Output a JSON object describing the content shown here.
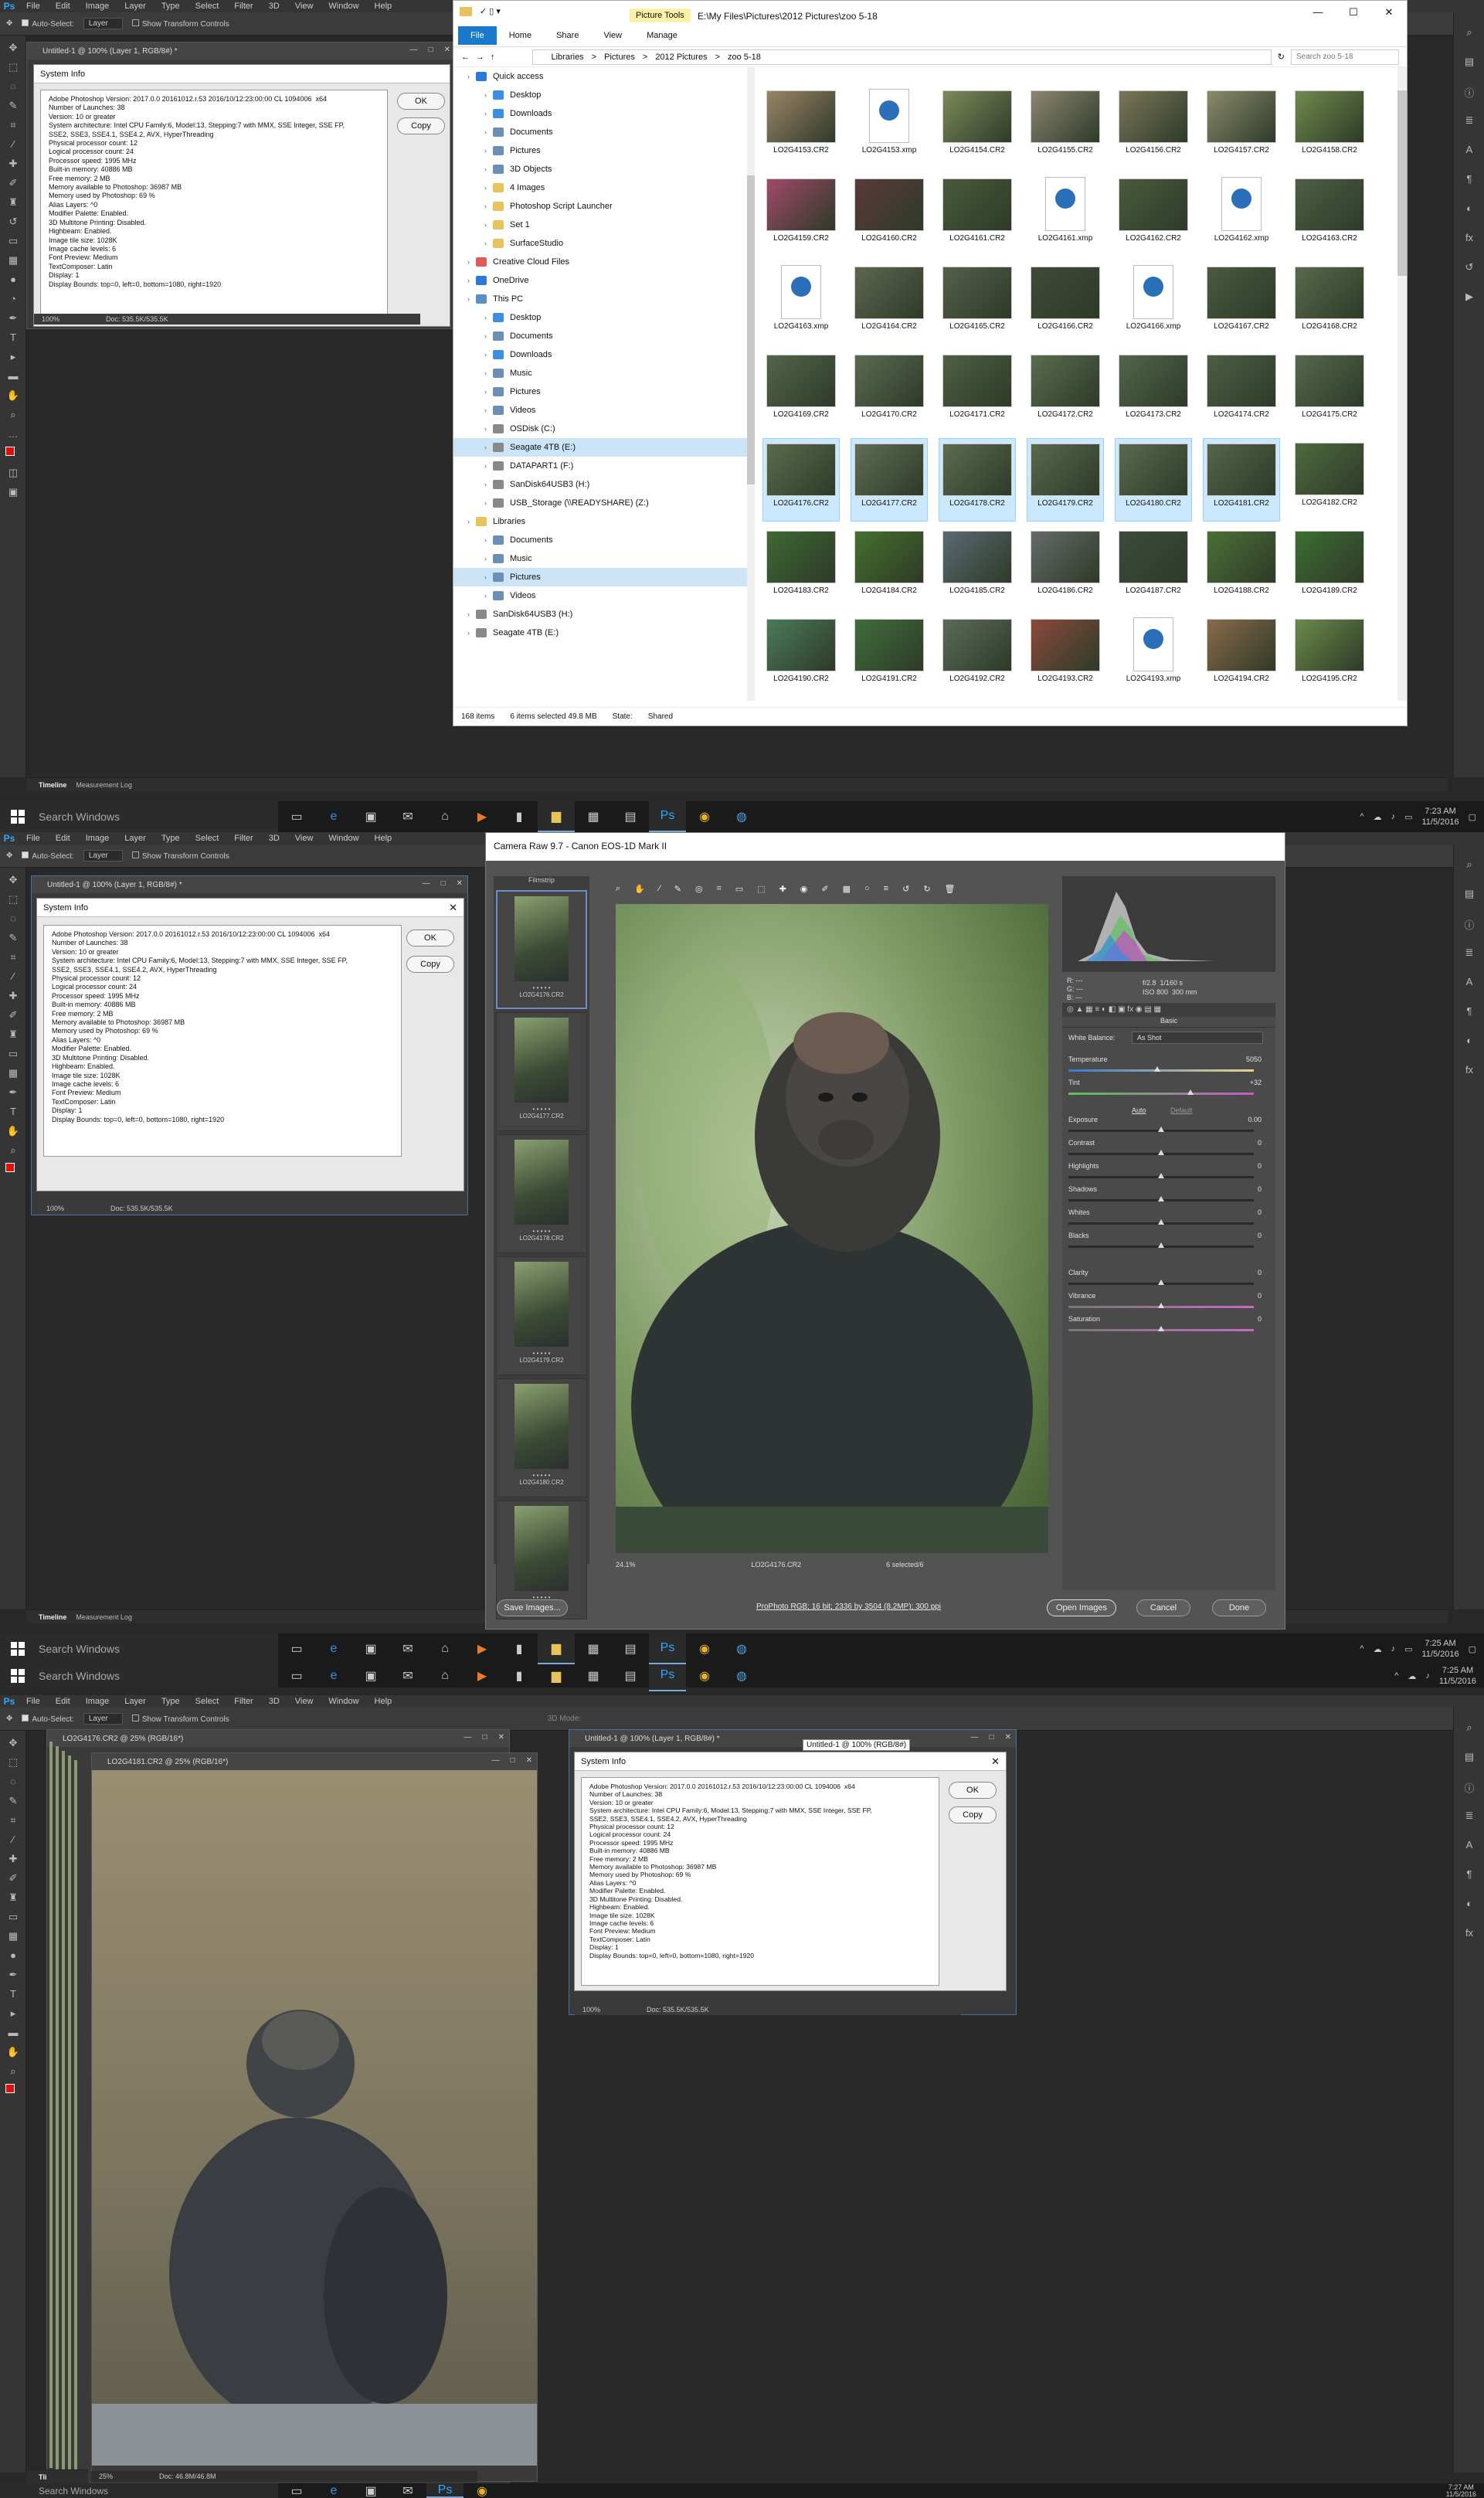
{
  "ps": {
    "logo": "Ps",
    "menu": [
      "File",
      "Edit",
      "Image",
      "Layer",
      "Type",
      "Select",
      "Filter",
      "3D",
      "View",
      "Window",
      "Help"
    ],
    "options": {
      "auto_select": "Auto-Select:",
      "layer_value": "Layer",
      "show_transform": "Show Transform Controls",
      "mode_3d": "3D Mode:"
    },
    "doc_title": "Untitled-1 @ 100% (Layer 1, RGB/8#) *",
    "doc_tooltip": "Untitled-1 @ 100% (RGB/8#)",
    "zoom": "100%",
    "doc_size": "Doc: 535.5K/535.5K",
    "bottom_tabs": [
      "Timeline",
      "Measurement Log"
    ],
    "sysinfo": {
      "title": "System Info",
      "ok": "OK",
      "copy": "Copy",
      "text": "Adobe Photoshop Version: 2017.0.0 20161012.r.53 2016/10/12:23:00:00 CL 1094006  x64\nNumber of Launches: 38\nVersion: 10 or greater\nSystem architecture: Intel CPU Family:6, Model:13, Stepping:7 with MMX, SSE Integer, SSE FP,\nSSE2, SSE3, SSE4.1, SSE4.2, AVX, HyperThreading\nPhysical processor count: 12\nLogical processor count: 24\nProcessor speed: 1995 MHz\nBuilt-in memory: 40886 MB\nFree memory: 2 MB\nMemory available to Photoshop: 36987 MB\nMemory used by Photoshop: 69 %\nAlias Layers: ^0\nModifier Palette: Enabled.\n3D Multitone Printing: Disabled.\nHighbeam: Enabled.\nImage tile size: 1028K\nImage cache levels: 6\nFont Preview: Medium\nTextComposer: Latin\nDisplay: 1\nDisplay Bounds: top=0, left=0, bottom=1080, right=1920"
    }
  },
  "explorer": {
    "ribbon_tag": "Picture Tools",
    "title_path": "E:\\My Files\\Pictures\\2012 Pictures\\zoo 5-18",
    "tabs": [
      "File",
      "Home",
      "Share",
      "View",
      "Manage"
    ],
    "breadcrumb": [
      "Libraries",
      ">",
      "Pictures",
      ">",
      "2012 Pictures",
      ">",
      "zoo 5-18"
    ],
    "search_placeholder": "Search zoo 5-18",
    "nav": [
      {
        "label": "Quick access",
        "level": 1,
        "color": "#2b79d6"
      },
      {
        "label": "Desktop",
        "level": 2,
        "color": "#3d8fe0"
      },
      {
        "label": "Downloads",
        "level": 2,
        "color": "#3d8fe0"
      },
      {
        "label": "Documents",
        "level": 2,
        "color": "#6b8fb5"
      },
      {
        "label": "Pictures",
        "level": 2,
        "color": "#6b8fb5"
      },
      {
        "label": "3D Objects",
        "level": 2,
        "color": "#6b8fb5"
      },
      {
        "label": "4 Images",
        "level": 2,
        "color": "#e8c25a"
      },
      {
        "label": "Photoshop Script Launcher",
        "level": 2,
        "color": "#e8c25a"
      },
      {
        "label": "Set 1",
        "level": 2,
        "color": "#e8c25a"
      },
      {
        "label": "SurfaceStudio",
        "level": 2,
        "color": "#e8c25a"
      },
      {
        "label": "Creative Cloud Files",
        "level": 1,
        "color": "#e05a5a"
      },
      {
        "label": "OneDrive",
        "level": 1,
        "color": "#2b79d6"
      },
      {
        "label": "This PC",
        "level": 1,
        "color": "#5a8fc4"
      },
      {
        "label": "Desktop",
        "level": 2,
        "color": "#3d8fe0"
      },
      {
        "label": "Documents",
        "level": 2,
        "color": "#6b8fb5"
      },
      {
        "label": "Downloads",
        "level": 2,
        "color": "#3d8fe0"
      },
      {
        "label": "Music",
        "level": 2,
        "color": "#6b8fb5"
      },
      {
        "label": "Pictures",
        "level": 2,
        "color": "#6b8fb5"
      },
      {
        "label": "Videos",
        "level": 2,
        "color": "#6b8fb5"
      },
      {
        "label": "OSDisk (C:)",
        "level": 2,
        "color": "#888"
      },
      {
        "label": "Seagate 4TB (E:)",
        "level": 2,
        "color": "#888",
        "selected": true
      },
      {
        "label": "DATAPART1 (F:)",
        "level": 2,
        "color": "#888"
      },
      {
        "label": "SanDisk64USB3 (H:)",
        "level": 2,
        "color": "#888"
      },
      {
        "label": "USB_Storage (\\\\READYSHARE) (Z:)",
        "level": 2,
        "color": "#888"
      },
      {
        "label": "Libraries",
        "level": 1,
        "color": "#e8c25a"
      },
      {
        "label": "Documents",
        "level": 2,
        "color": "#6b8fb5"
      },
      {
        "label": "Music",
        "level": 2,
        "color": "#6b8fb5"
      },
      {
        "label": "Pictures",
        "level": 2,
        "color": "#6b8fb5",
        "selected": true
      },
      {
        "label": "Videos",
        "level": 2,
        "color": "#6b8fb5"
      },
      {
        "label": "SanDisk64USB3 (H:)",
        "level": 1,
        "color": "#888"
      },
      {
        "label": "Seagate 4TB (E:)",
        "level": 1,
        "color": "#888"
      }
    ],
    "files": [
      {
        "name": "LO2G4153.CR2",
        "t": "img",
        "c": "#9a8466"
      },
      {
        "name": "LO2G4153.xmp",
        "t": "xmp"
      },
      {
        "name": "LO2G4154.CR2",
        "t": "img",
        "c": "#7c8a5a"
      },
      {
        "name": "LO2G4155.CR2",
        "t": "img",
        "c": "#8c8670"
      },
      {
        "name": "LO2G4156.CR2",
        "t": "img",
        "c": "#7a7658"
      },
      {
        "name": "LO2G4157.CR2",
        "t": "img",
        "c": "#8b8a6c"
      },
      {
        "name": "LO2G4158.CR2",
        "t": "img",
        "c": "#6f8a4e"
      },
      {
        "name": "LO2G4159.CR2",
        "t": "img",
        "c": "#a04a6a"
      },
      {
        "name": "LO2G4160.CR2",
        "t": "img",
        "c": "#5a3a3a"
      },
      {
        "name": "LO2G4161.CR2",
        "t": "img",
        "c": "#4a5a3a"
      },
      {
        "name": "LO2G4161.xmp",
        "t": "xmp"
      },
      {
        "name": "LO2G4162.CR2",
        "t": "img",
        "c": "#4b5a3c"
      },
      {
        "name": "LO2G4162.xmp",
        "t": "xmp"
      },
      {
        "name": "LO2G4163.CR2",
        "t": "img",
        "c": "#4e5e44"
      },
      {
        "name": "LO2G4163.xmp",
        "t": "xmp"
      },
      {
        "name": "LO2G4164.CR2",
        "t": "img",
        "c": "#5e6650"
      },
      {
        "name": "LO2G4165.CR2",
        "t": "img",
        "c": "#54604a"
      },
      {
        "name": "LO2G4166.CR2",
        "t": "img",
        "c": "#404a38"
      },
      {
        "name": "LO2G4166.xmp",
        "t": "xmp"
      },
      {
        "name": "LO2G4167.CR2",
        "t": "img",
        "c": "#4a5a40"
      },
      {
        "name": "LO2G4168.CR2",
        "t": "img",
        "c": "#586a4c"
      },
      {
        "name": "LO2G4169.CR2",
        "t": "img",
        "c": "#55644a"
      },
      {
        "name": "LO2G4170.CR2",
        "t": "img",
        "c": "#5c6a52"
      },
      {
        "name": "LO2G4171.CR2",
        "t": "img",
        "c": "#4e6044"
      },
      {
        "name": "LO2G4172.CR2",
        "t": "img",
        "c": "#5a6c4e"
      },
      {
        "name": "LO2G4173.CR2",
        "t": "img",
        "c": "#52664a"
      },
      {
        "name": "LO2G4174.CR2",
        "t": "img",
        "c": "#4c5e44"
      },
      {
        "name": "LO2G4175.CR2",
        "t": "img",
        "c": "#56684c"
      },
      {
        "name": "LO2G4176.CR2",
        "t": "img",
        "c": "#5a6c4c",
        "sel": true
      },
      {
        "name": "LO2G4177.CR2",
        "t": "img",
        "c": "#606e54",
        "sel": true
      },
      {
        "name": "LO2G4178.CR2",
        "t": "img",
        "c": "#5c6c50",
        "sel": true
      },
      {
        "name": "LO2G4179.CR2",
        "t": "img",
        "c": "#586a4e",
        "sel": true
      },
      {
        "name": "LO2G4180.CR2",
        "t": "img",
        "c": "#5a6a50",
        "sel": true
      },
      {
        "name": "LO2G4181.CR2",
        "t": "img",
        "c": "#54664a",
        "sel": true
      },
      {
        "name": "LO2G4182.CR2",
        "t": "img",
        "c": "#4e6a3e"
      },
      {
        "name": "LO2G4183.CR2",
        "t": "img",
        "c": "#3e6a34"
      },
      {
        "name": "LO2G4184.CR2",
        "t": "img",
        "c": "#44702e"
      },
      {
        "name": "LO2G4185.CR2",
        "t": "img",
        "c": "#5a6a74"
      },
      {
        "name": "LO2G4186.CR2",
        "t": "img",
        "c": "#666a6a"
      },
      {
        "name": "LO2G4187.CR2",
        "t": "img",
        "c": "#3e4a3c"
      },
      {
        "name": "LO2G4188.CR2",
        "t": "img",
        "c": "#4a7036"
      },
      {
        "name": "LO2G4189.CR2",
        "t": "img",
        "c": "#3c6e32"
      },
      {
        "name": "LO2G4190.CR2",
        "t": "img",
        "c": "#4a7a5a"
      },
      {
        "name": "LO2G4191.CR2",
        "t": "img",
        "c": "#3e6e3a"
      },
      {
        "name": "LO2G4192.CR2",
        "t": "img",
        "c": "#5c6a5a"
      },
      {
        "name": "LO2G4193.CR2",
        "t": "img",
        "c": "#8a4a3a"
      },
      {
        "name": "LO2G4193.xmp",
        "t": "xmp"
      },
      {
        "name": "LO2G4194.CR2",
        "t": "img",
        "c": "#8a6a4a"
      },
      {
        "name": "LO2G4195.CR2",
        "t": "img",
        "c": "#6a8a4a"
      }
    ],
    "status": {
      "count": "168 items",
      "selected": "6 items selected  49.8 MB",
      "state": "State:",
      "shared": "Shared"
    }
  },
  "taskbar": {
    "search": "Search Windows",
    "times": [
      {
        "time": "7:23 AM",
        "date": "11/5/2016"
      },
      {
        "time": "7:25 AM",
        "date": "11/5/2016"
      },
      {
        "time": "7:27 AM",
        "date": "11/5/2016"
      }
    ]
  },
  "camera_raw": {
    "title": "Camera Raw 9.7  -  Canon EOS-1D Mark II",
    "filmstrip_label": "Filmstrip",
    "films": [
      "LO2G4176.CR2",
      "LO2G4177.CR2",
      "LO2G4178.CR2",
      "LO2G4179.CR2",
      "LO2G4180.CR2",
      "LO2G4181.CR2"
    ],
    "zoom": "24.1%",
    "current_file": "LO2G4176.CR2",
    "selected": "6 selected/6",
    "rgb": {
      "r": "R:",
      "g": "G:",
      "b": "B:",
      "r_val": "---",
      "g_val": "---",
      "b_val": "---"
    },
    "exif": {
      "aperture": "f/2.8",
      "shutter": "1/160 s",
      "iso": "ISO 800",
      "focal": "300 mm"
    },
    "panel": "Basic",
    "wb_label": "White Balance:",
    "wb_value": "As Shot",
    "auto": "Auto",
    "default": "Default",
    "sliders": [
      {
        "name": "Temperature",
        "value": "5050",
        "pos": 0.48
      },
      {
        "name": "Tint",
        "value": "+32",
        "pos": 0.66
      },
      {
        "name": "Exposure",
        "value": "0.00",
        "pos": 0.5
      },
      {
        "name": "Contrast",
        "value": "0",
        "pos": 0.5
      },
      {
        "name": "Highlights",
        "value": "0",
        "pos": 0.5
      },
      {
        "name": "Shadows",
        "value": "0",
        "pos": 0.5
      },
      {
        "name": "Whites",
        "value": "0",
        "pos": 0.5
      },
      {
        "name": "Blacks",
        "value": "0",
        "pos": 0.5
      },
      {
        "name": "Clarity",
        "value": "0",
        "pos": 0.5
      },
      {
        "name": "Vibrance",
        "value": "0",
        "pos": 0.5
      },
      {
        "name": "Saturation",
        "value": "0",
        "pos": 0.5
      }
    ],
    "save": "Save Images...",
    "workflow": "ProPhoto RGB; 16 bit; 2336 by 3504 (8.2MP); 300 ppi",
    "open": "Open Images",
    "cancel": "Cancel",
    "done": "Done"
  },
  "screen3": {
    "doc_back": "LO2G4176.CR2 @ 25% (RGB/16*)",
    "doc_front": "LO2G4181.CR2 @ 25% (RGB/16*)",
    "zoom": "25%",
    "doc_size": "Doc: 46.8M/46.8M",
    "tab_short": "Tli"
  }
}
